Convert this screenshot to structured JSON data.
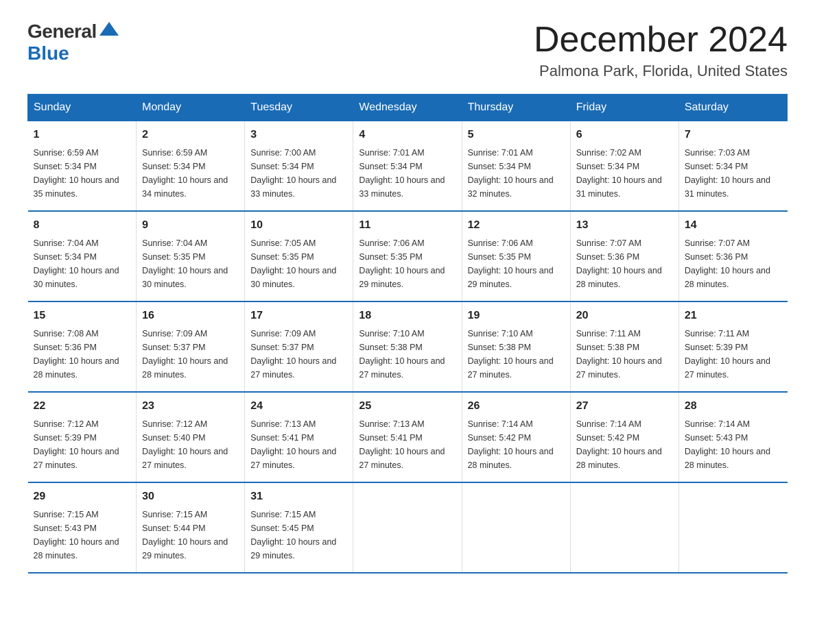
{
  "logo": {
    "general": "General",
    "blue": "Blue"
  },
  "title": "December 2024",
  "location": "Palmona Park, Florida, United States",
  "weekdays": [
    "Sunday",
    "Monday",
    "Tuesday",
    "Wednesday",
    "Thursday",
    "Friday",
    "Saturday"
  ],
  "weeks": [
    [
      {
        "day": "1",
        "sunrise": "6:59 AM",
        "sunset": "5:34 PM",
        "daylight": "10 hours and 35 minutes."
      },
      {
        "day": "2",
        "sunrise": "6:59 AM",
        "sunset": "5:34 PM",
        "daylight": "10 hours and 34 minutes."
      },
      {
        "day": "3",
        "sunrise": "7:00 AM",
        "sunset": "5:34 PM",
        "daylight": "10 hours and 33 minutes."
      },
      {
        "day": "4",
        "sunrise": "7:01 AM",
        "sunset": "5:34 PM",
        "daylight": "10 hours and 33 minutes."
      },
      {
        "day": "5",
        "sunrise": "7:01 AM",
        "sunset": "5:34 PM",
        "daylight": "10 hours and 32 minutes."
      },
      {
        "day": "6",
        "sunrise": "7:02 AM",
        "sunset": "5:34 PM",
        "daylight": "10 hours and 31 minutes."
      },
      {
        "day": "7",
        "sunrise": "7:03 AM",
        "sunset": "5:34 PM",
        "daylight": "10 hours and 31 minutes."
      }
    ],
    [
      {
        "day": "8",
        "sunrise": "7:04 AM",
        "sunset": "5:34 PM",
        "daylight": "10 hours and 30 minutes."
      },
      {
        "day": "9",
        "sunrise": "7:04 AM",
        "sunset": "5:35 PM",
        "daylight": "10 hours and 30 minutes."
      },
      {
        "day": "10",
        "sunrise": "7:05 AM",
        "sunset": "5:35 PM",
        "daylight": "10 hours and 30 minutes."
      },
      {
        "day": "11",
        "sunrise": "7:06 AM",
        "sunset": "5:35 PM",
        "daylight": "10 hours and 29 minutes."
      },
      {
        "day": "12",
        "sunrise": "7:06 AM",
        "sunset": "5:35 PM",
        "daylight": "10 hours and 29 minutes."
      },
      {
        "day": "13",
        "sunrise": "7:07 AM",
        "sunset": "5:36 PM",
        "daylight": "10 hours and 28 minutes."
      },
      {
        "day": "14",
        "sunrise": "7:07 AM",
        "sunset": "5:36 PM",
        "daylight": "10 hours and 28 minutes."
      }
    ],
    [
      {
        "day": "15",
        "sunrise": "7:08 AM",
        "sunset": "5:36 PM",
        "daylight": "10 hours and 28 minutes."
      },
      {
        "day": "16",
        "sunrise": "7:09 AM",
        "sunset": "5:37 PM",
        "daylight": "10 hours and 28 minutes."
      },
      {
        "day": "17",
        "sunrise": "7:09 AM",
        "sunset": "5:37 PM",
        "daylight": "10 hours and 27 minutes."
      },
      {
        "day": "18",
        "sunrise": "7:10 AM",
        "sunset": "5:38 PM",
        "daylight": "10 hours and 27 minutes."
      },
      {
        "day": "19",
        "sunrise": "7:10 AM",
        "sunset": "5:38 PM",
        "daylight": "10 hours and 27 minutes."
      },
      {
        "day": "20",
        "sunrise": "7:11 AM",
        "sunset": "5:38 PM",
        "daylight": "10 hours and 27 minutes."
      },
      {
        "day": "21",
        "sunrise": "7:11 AM",
        "sunset": "5:39 PM",
        "daylight": "10 hours and 27 minutes."
      }
    ],
    [
      {
        "day": "22",
        "sunrise": "7:12 AM",
        "sunset": "5:39 PM",
        "daylight": "10 hours and 27 minutes."
      },
      {
        "day": "23",
        "sunrise": "7:12 AM",
        "sunset": "5:40 PM",
        "daylight": "10 hours and 27 minutes."
      },
      {
        "day": "24",
        "sunrise": "7:13 AM",
        "sunset": "5:41 PM",
        "daylight": "10 hours and 27 minutes."
      },
      {
        "day": "25",
        "sunrise": "7:13 AM",
        "sunset": "5:41 PM",
        "daylight": "10 hours and 27 minutes."
      },
      {
        "day": "26",
        "sunrise": "7:14 AM",
        "sunset": "5:42 PM",
        "daylight": "10 hours and 28 minutes."
      },
      {
        "day": "27",
        "sunrise": "7:14 AM",
        "sunset": "5:42 PM",
        "daylight": "10 hours and 28 minutes."
      },
      {
        "day": "28",
        "sunrise": "7:14 AM",
        "sunset": "5:43 PM",
        "daylight": "10 hours and 28 minutes."
      }
    ],
    [
      {
        "day": "29",
        "sunrise": "7:15 AM",
        "sunset": "5:43 PM",
        "daylight": "10 hours and 28 minutes."
      },
      {
        "day": "30",
        "sunrise": "7:15 AM",
        "sunset": "5:44 PM",
        "daylight": "10 hours and 29 minutes."
      },
      {
        "day": "31",
        "sunrise": "7:15 AM",
        "sunset": "5:45 PM",
        "daylight": "10 hours and 29 minutes."
      },
      null,
      null,
      null,
      null
    ]
  ],
  "labels": {
    "sunrise": "Sunrise:",
    "sunset": "Sunset:",
    "daylight": "Daylight:"
  }
}
